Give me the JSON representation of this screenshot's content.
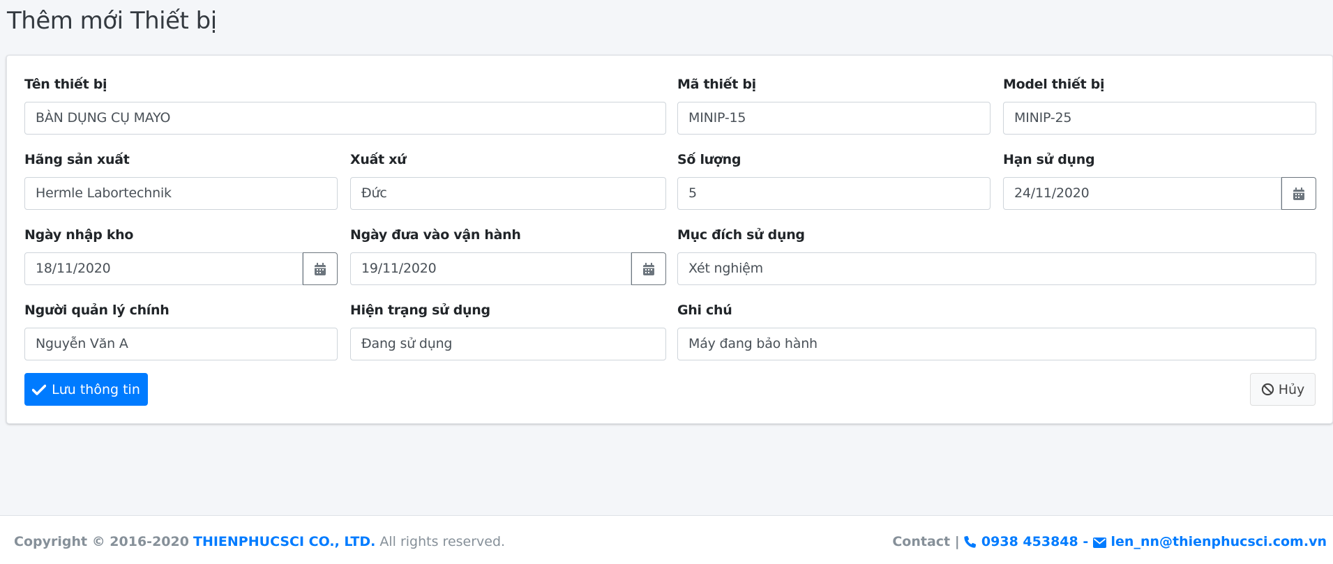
{
  "page": {
    "title": "Thêm mới Thiết bị"
  },
  "form": {
    "ten_thiet_bi": {
      "label": "Tên thiết bị",
      "value": "BÀN DỤNG CỤ MAYO"
    },
    "ma_thiet_bi": {
      "label": "Mã thiết bị",
      "value": "MINIP-15"
    },
    "model_thiet_bi": {
      "label": "Model thiết bị",
      "value": "MINIP-25"
    },
    "hang_san_xuat": {
      "label": "Hãng sản xuất",
      "value": "Hermle Labortechnik"
    },
    "xuat_xu": {
      "label": "Xuất xứ",
      "value": "Đức"
    },
    "so_luong": {
      "label": "Số lượng",
      "value": "5"
    },
    "han_su_dung": {
      "label": "Hạn sử dụng",
      "value": "24/11/2020"
    },
    "ngay_nhap_kho": {
      "label": "Ngày nhập kho",
      "value": "18/11/2020"
    },
    "ngay_dua_vao_van_hanh": {
      "label": "Ngày đưa vào vận hành",
      "value": "19/11/2020"
    },
    "muc_dich_su_dung": {
      "label": "Mục đích sử dụng",
      "value": "Xét nghiệm"
    },
    "nguoi_quan_ly_chinh": {
      "label": "Người quản lý chính",
      "value": "Nguyễn Văn A"
    },
    "hien_trang_su_dung": {
      "label": "Hiện trạng sử dụng",
      "value": "Đang sử dụng"
    },
    "ghi_chu": {
      "label": "Ghi chú",
      "value": "Máy đang bảo hành"
    }
  },
  "actions": {
    "save_label": "Lưu thông tin",
    "cancel_label": "Hủy"
  },
  "footer": {
    "copyright": "Copyright © 2016-2020",
    "company": "THIENPHUCSCI CO., LTD.",
    "rights": "All rights reserved.",
    "contact_label": "Contact |",
    "phone": "0938 453848",
    "separator": "-",
    "email": "len_nn@thienphucsci.com.vn"
  },
  "icons": {
    "calendar": "calendar-icon",
    "check": "check-icon",
    "ban": "ban-icon",
    "phone": "phone-icon",
    "envelope": "envelope-icon"
  },
  "colors": {
    "primary": "#007bff",
    "background": "#f4f6f9",
    "text": "#212529",
    "muted": "#869099"
  }
}
